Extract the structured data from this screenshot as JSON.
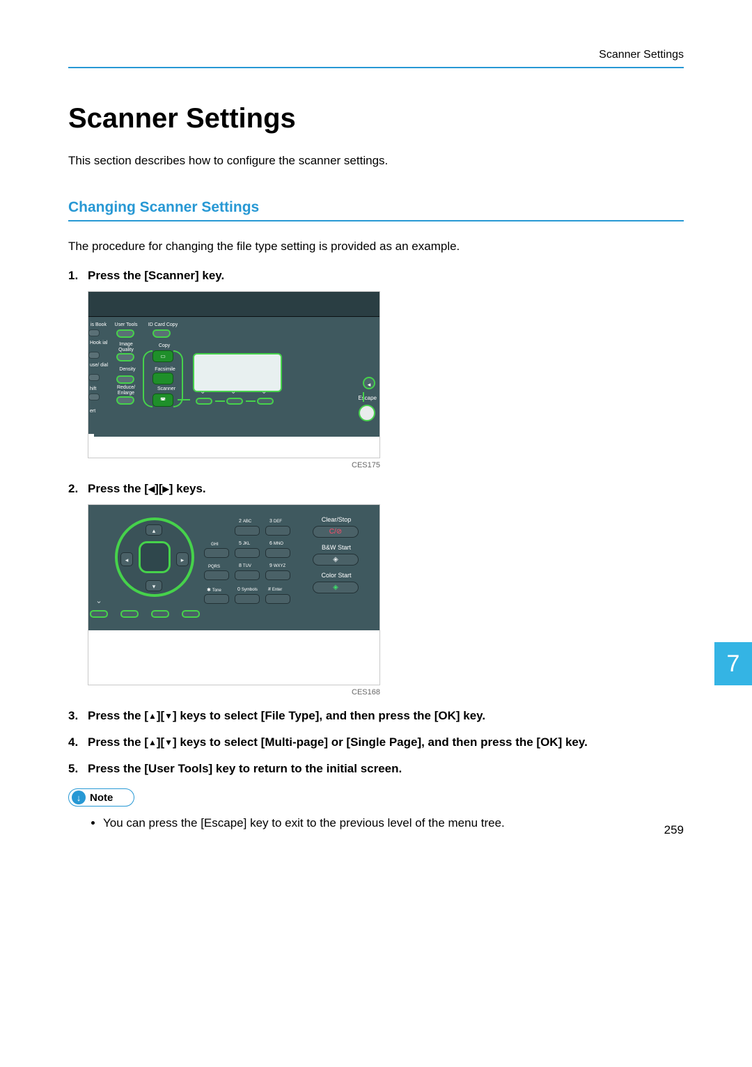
{
  "header": {
    "breadcrumb": "Scanner Settings"
  },
  "title": "Scanner Settings",
  "intro": "This section describes how to configure the scanner settings.",
  "section": {
    "heading": "Changing Scanner Settings",
    "intro": "The procedure for changing the file type setting is provided as an example."
  },
  "steps": {
    "s1": "Press the [Scanner] key.",
    "s2_pre": "Press the [",
    "s2_mid": "][",
    "s2_post": "] keys.",
    "s3_pre": "Press the [",
    "s3_mid1": "][",
    "s3_mid2": "] keys to select [File Type], and then press the [OK] key.",
    "s4_pre": "Press the [",
    "s4_mid1": "][",
    "s4_mid2": "] keys to select [Multi-page] or [Single Page], and then press the [OK] key.",
    "s5": "Press the [User Tools] key to return to the initial screen."
  },
  "figure1": {
    "caption": "CES175",
    "labels": {
      "is_book": "is Book",
      "user_tools": "User Tools",
      "id_card_copy": "ID Card Copy",
      "hook_dial": "Hook\nial",
      "image_quality": "Image\nQuality",
      "copy": "Copy",
      "pause_redial": "use/\ndial",
      "density": "Density",
      "facsimile": "Facsimile",
      "shift": "hift",
      "reduce_enlarge": "Reduce/\nEnlarge",
      "scanner": "Scanner",
      "insert": "ert",
      "escape": "Escape"
    }
  },
  "figure2": {
    "caption": "CES168",
    "keypad": {
      "k2": "2",
      "k2s": "ABC",
      "k3": "3",
      "k3s": "DEF",
      "k4s": "GHI",
      "k5": "5",
      "k5s": "JKL",
      "k6": "6",
      "k6s": "MNO",
      "k7s": "PQRS",
      "k8": "8",
      "k8s": "TUV",
      "k9": "9",
      "k9s": "WXYZ",
      "star": "Tone",
      "k0": "0",
      "k0s": "Symbols",
      "hash": "#",
      "hashs": "Enter"
    },
    "actions": {
      "clear_stop": "Clear/Stop",
      "clear_sym": "C/⊘",
      "bw_start": "B&W Start",
      "color_start": "Color Start"
    },
    "dir": {
      "up": "▴",
      "down": "▾",
      "left": "◂",
      "right": "▸"
    }
  },
  "note": {
    "label": "Note",
    "item1": "You can press the [Escape] key to exit to the previous level of the menu tree."
  },
  "chapter": "7",
  "page_number": "259"
}
